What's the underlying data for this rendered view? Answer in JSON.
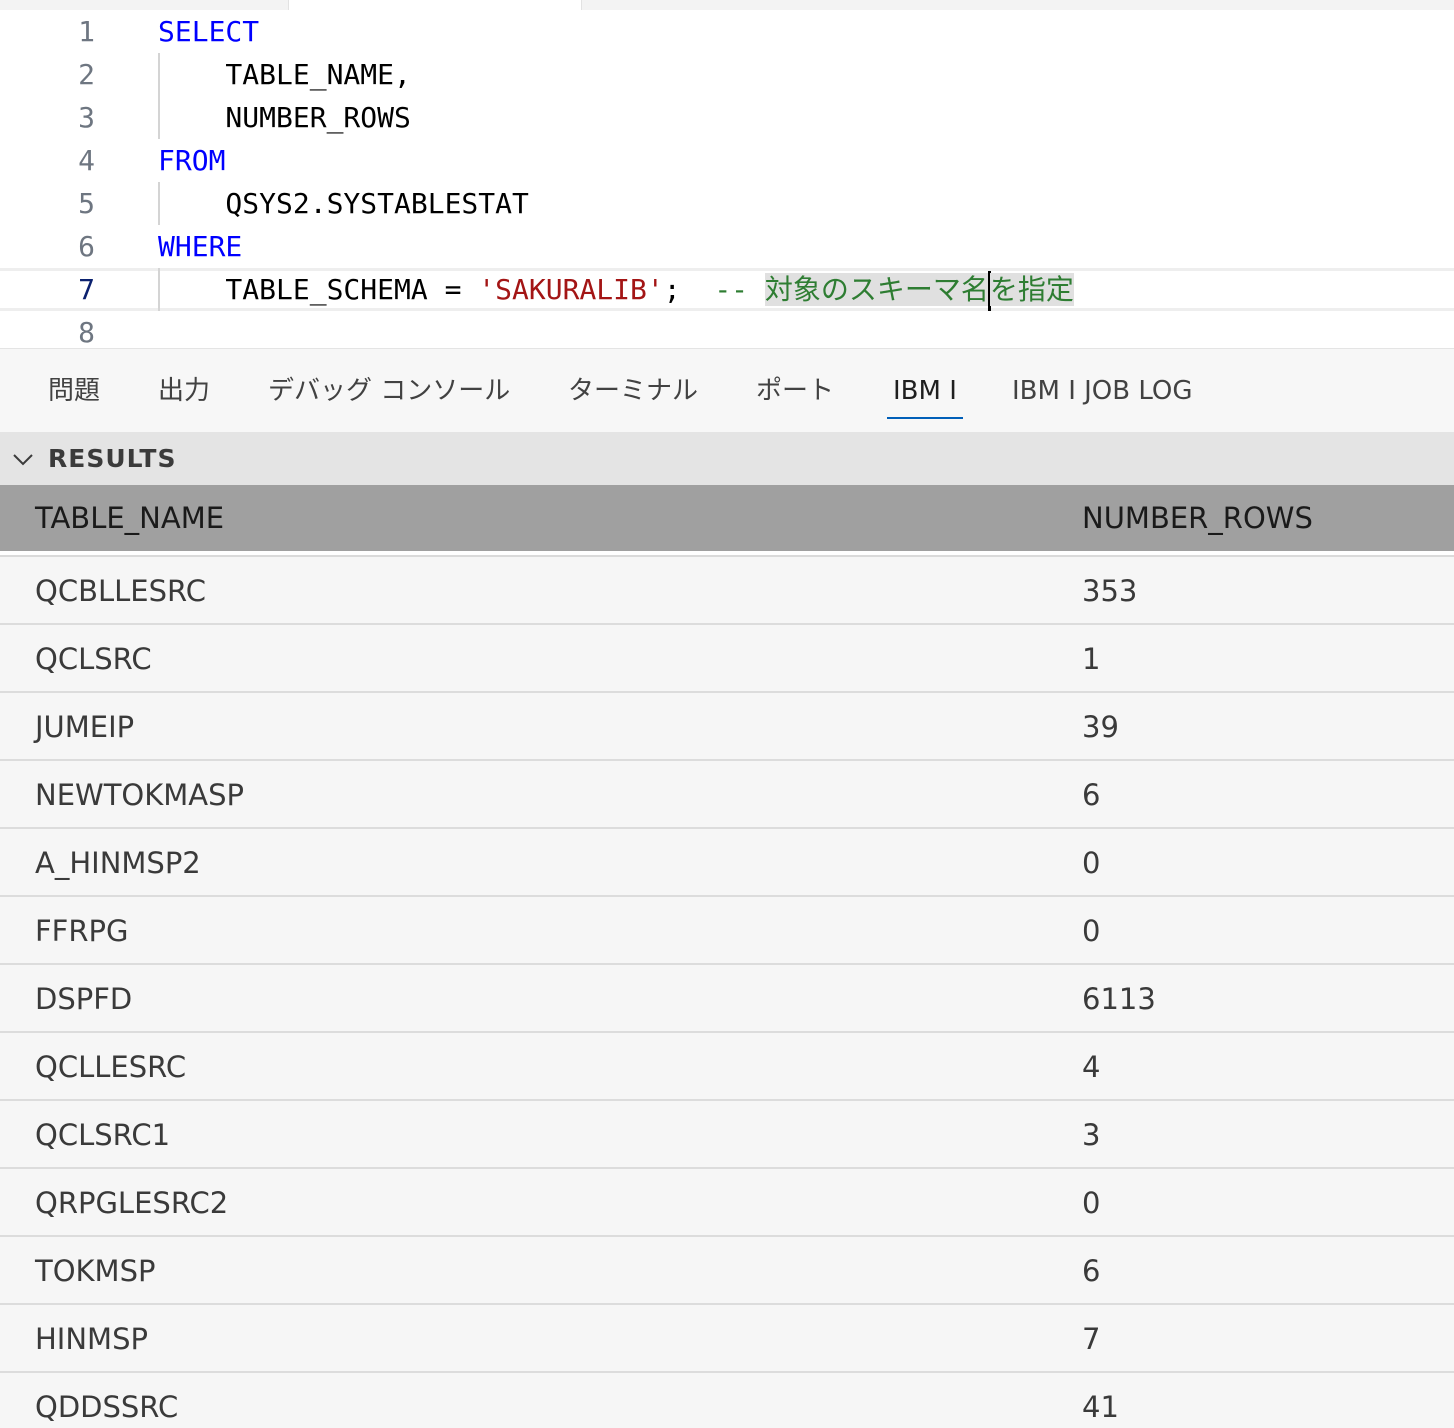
{
  "editor": {
    "lines": [
      {
        "number": "1",
        "tokens": [
          {
            "t": "SELECT",
            "c": "kw"
          }
        ]
      },
      {
        "number": "2",
        "tokens": [
          {
            "t": "    TABLE_NAME,",
            "c": "txt"
          }
        ]
      },
      {
        "number": "3",
        "tokens": [
          {
            "t": "    NUMBER_ROWS",
            "c": "txt"
          }
        ]
      },
      {
        "number": "4",
        "tokens": [
          {
            "t": "FROM",
            "c": "kw"
          }
        ]
      },
      {
        "number": "5",
        "tokens": [
          {
            "t": "    QSYS2.SYSTABLESTAT",
            "c": "txt"
          }
        ]
      },
      {
        "number": "6",
        "tokens": [
          {
            "t": "WHERE",
            "c": "kw"
          }
        ]
      },
      {
        "number": "7",
        "tokens": [
          {
            "t": "    TABLE_SCHEMA = ",
            "c": "txt"
          },
          {
            "t": "'SAKURALIB'",
            "c": "str"
          },
          {
            "t": ";  ",
            "c": "txt"
          },
          {
            "t": "-- ",
            "c": "cmt"
          },
          {
            "t": "対象のスキーマ名",
            "c": "cmt sel"
          },
          {
            "t": "",
            "c": "cursor"
          },
          {
            "t": "を指定",
            "c": "cmt sel"
          }
        ]
      },
      {
        "number": "8",
        "tokens": []
      }
    ]
  },
  "panel": {
    "tabs": [
      {
        "label": "問題",
        "active": false
      },
      {
        "label": "出力",
        "active": false
      },
      {
        "label": "デバッグ コンソール",
        "active": false
      },
      {
        "label": "ターミナル",
        "active": false
      },
      {
        "label": "ポート",
        "active": false
      },
      {
        "label": "IBM I",
        "active": true
      },
      {
        "label": "IBM I JOB LOG",
        "active": false
      }
    ]
  },
  "results": {
    "title": "RESULTS",
    "columns": [
      "TABLE_NAME",
      "NUMBER_ROWS"
    ],
    "rows": [
      [
        "QCBLLESRC",
        "353"
      ],
      [
        "QCLSRC",
        "1"
      ],
      [
        "JUMEIP",
        "39"
      ],
      [
        "NEWTOKMASP",
        "6"
      ],
      [
        "A_HINMSP2",
        "0"
      ],
      [
        "FFRPG",
        "0"
      ],
      [
        "DSPFD",
        "6113"
      ],
      [
        "QCLLESRC",
        "4"
      ],
      [
        "QCLSRC1",
        "3"
      ],
      [
        "QRPGLESRC2",
        "0"
      ],
      [
        "TOKMSP",
        "6"
      ],
      [
        "HINMSP",
        "7"
      ],
      [
        "QDDSSRC",
        "41"
      ]
    ]
  },
  "colors": {
    "keyword": "#0000ff",
    "string": "#a31515",
    "comment": "#2e7d32",
    "active_tab_underline": "#005fb8",
    "table_header_bg": "#a0a0a0"
  }
}
